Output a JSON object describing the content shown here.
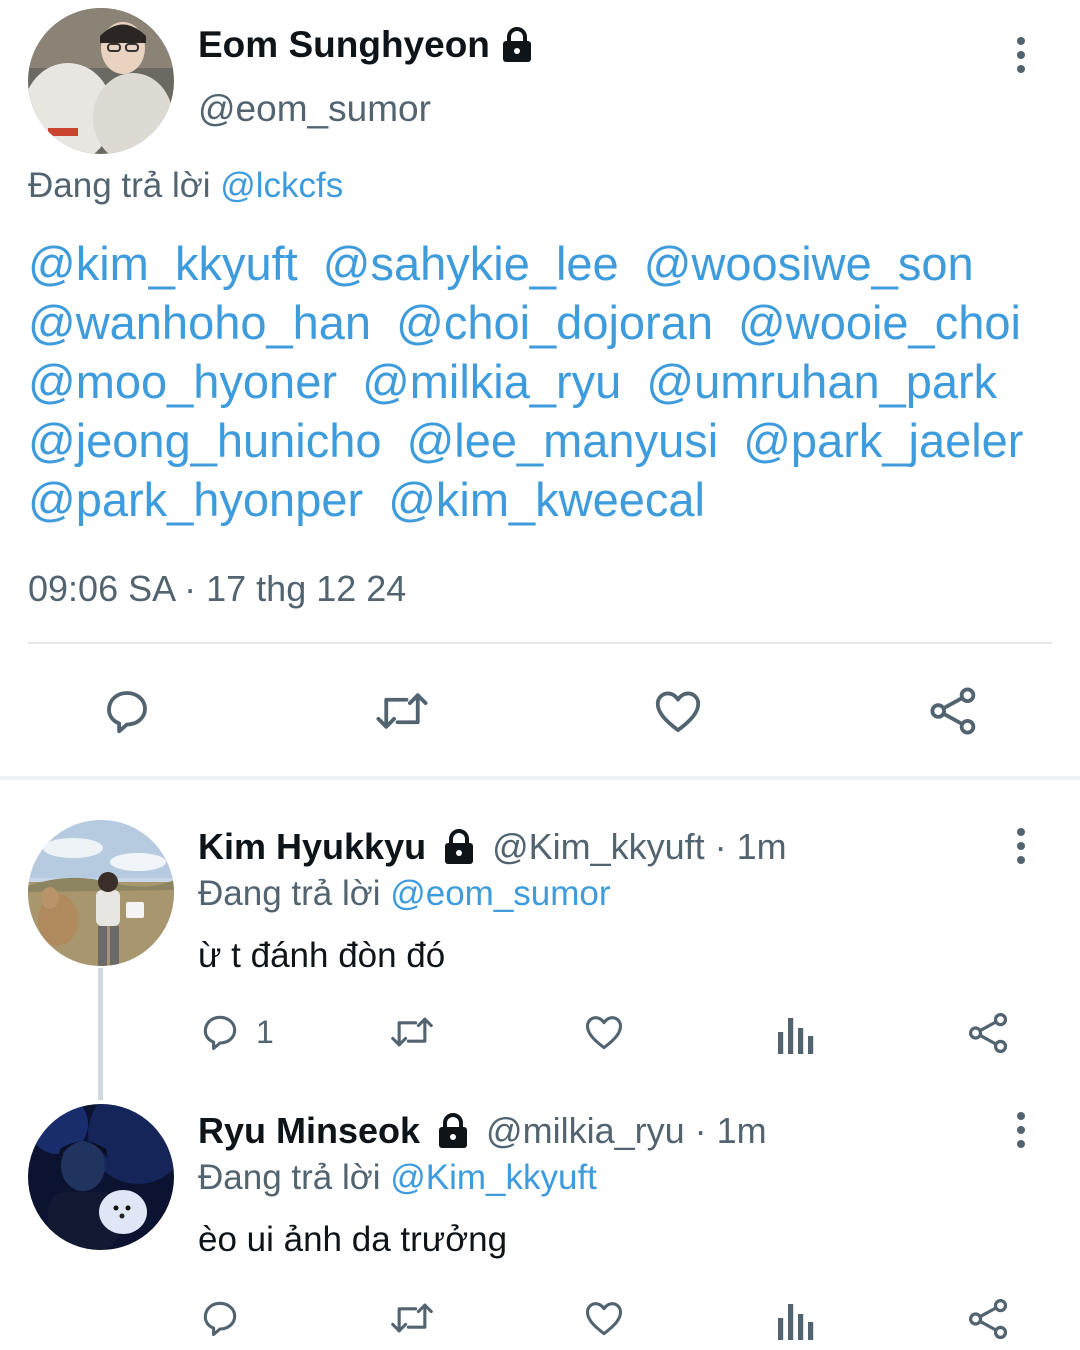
{
  "main_tweet": {
    "author_name": "Eom Sunghyeon",
    "author_handle": "@eom_sumor",
    "replying_prefix": "Đang trả lời",
    "replying_to": "@lckcfs",
    "mentions": [
      "@kim_kkyuft",
      "@sahykie_lee",
      "@woosiwe_son",
      "@wanhoho_han",
      "@choi_dojoran",
      "@wooie_choi",
      "@moo_hyoner",
      "@milkia_ryu",
      "@umruhan_park",
      "@jeong_hunicho",
      "@lee_manyusi",
      "@park_jaeler",
      "@park_hyonper",
      "@kim_kweecal"
    ],
    "timestamp": "09:06 SA · 17 thg 12 24",
    "actions": [
      "reply-icon",
      "retweet-icon",
      "like-icon",
      "share-icon"
    ]
  },
  "replies": [
    {
      "author_name": "Kim Hyukkyu",
      "author_handle": "@Kim_kkyuft",
      "time": "· 1m",
      "replying_prefix": "Đang trả lời",
      "replying_to": "@eom_sumor",
      "text": "ừ t đánh đòn đó",
      "reply_count": "1"
    },
    {
      "author_name": "Ryu Minseok",
      "author_handle": "@milkia_ryu",
      "time": "· 1m",
      "replying_prefix": "Đang trả lời",
      "replying_to": "@Kim_kkyuft",
      "text": "èo ui ảnh da trưởng",
      "reply_count": ""
    }
  ],
  "colors": {
    "link": "#3e9bdc",
    "secondary_text": "#536471",
    "primary_text": "#0f1419",
    "divider": "#e4e8eb"
  }
}
